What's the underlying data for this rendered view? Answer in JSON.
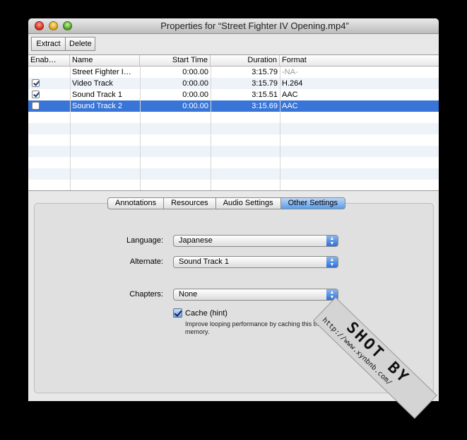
{
  "window": {
    "title": "Properties for “Street Fighter IV Opening.mp4”"
  },
  "toolbar": {
    "extract_label": "Extract",
    "delete_label": "Delete"
  },
  "table": {
    "columns": [
      "Enab…",
      "Name",
      "Start Time",
      "Duration",
      "Format"
    ],
    "rows": [
      {
        "enabled": null,
        "name": "Street Fighter I…",
        "start": "0:00.00",
        "duration": "3:15.79",
        "format": "-NA-"
      },
      {
        "enabled": true,
        "name": "Video Track",
        "start": "0:00.00",
        "duration": "3:15.79",
        "format": "H.264"
      },
      {
        "enabled": true,
        "name": "Sound Track 1",
        "start": "0:00.00",
        "duration": "3:15.51",
        "format": "AAC"
      },
      {
        "enabled": false,
        "name": "Sound Track 2",
        "start": "0:00.00",
        "duration": "3:15.69",
        "format": "AAC"
      }
    ]
  },
  "tabs": [
    "Annotations",
    "Resources",
    "Audio Settings",
    "Other Settings"
  ],
  "active_tab": "Other Settings",
  "settings": {
    "language_label": "Language:",
    "language_value": "Japanese",
    "alternate_label": "Alternate:",
    "alternate_value": "Sound Track 1",
    "chapters_label": "Chapters:",
    "chapters_value": "None",
    "cache_label": "Cache (hint)",
    "cache_checked": true,
    "cache_help": "Improve looping performance by caching this track in memory."
  },
  "watermark": {
    "title": "SHOT BY",
    "url": "http://www.xynbnb.com/"
  },
  "colors": {
    "selection": "#3875d7",
    "alt_row": "#eef3fa"
  }
}
